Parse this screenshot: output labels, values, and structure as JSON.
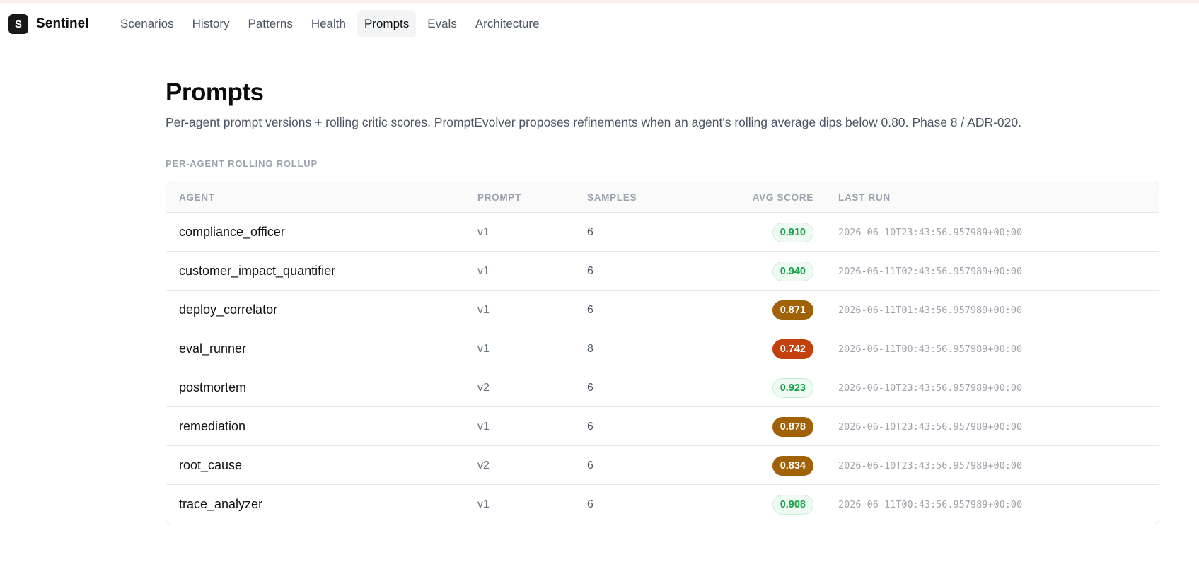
{
  "app": {
    "logo_letter": "S",
    "name": "Sentinel"
  },
  "nav": [
    {
      "label": "Scenarios",
      "active": false
    },
    {
      "label": "History",
      "active": false
    },
    {
      "label": "Patterns",
      "active": false
    },
    {
      "label": "Health",
      "active": false
    },
    {
      "label": "Prompts",
      "active": true
    },
    {
      "label": "Evals",
      "active": false
    },
    {
      "label": "Architecture",
      "active": false
    }
  ],
  "page": {
    "title": "Prompts",
    "description": "Per-agent prompt versions + rolling critic scores. PromptEvolver proposes refinements when an agent's rolling average dips below 0.80. Phase 8 / ADR-020.",
    "section_label": "PER-AGENT ROLLING ROLLUP"
  },
  "table": {
    "headers": {
      "agent": "AGENT",
      "prompt": "PROMPT",
      "samples": "SAMPLES",
      "avg_score": "AVG SCORE",
      "last_run": "LAST RUN"
    },
    "rows": [
      {
        "agent": "compliance_officer",
        "prompt": "v1",
        "samples": "6",
        "avg_score": "0.910",
        "status": "good",
        "last_run": "2026-06-10T23:43:56.957989+00:00"
      },
      {
        "agent": "customer_impact_quantifier",
        "prompt": "v1",
        "samples": "6",
        "avg_score": "0.940",
        "status": "good",
        "last_run": "2026-06-11T02:43:56.957989+00:00"
      },
      {
        "agent": "deploy_correlator",
        "prompt": "v1",
        "samples": "6",
        "avg_score": "0.871",
        "status": "warn",
        "last_run": "2026-06-11T01:43:56.957989+00:00"
      },
      {
        "agent": "eval_runner",
        "prompt": "v1",
        "samples": "8",
        "avg_score": "0.742",
        "status": "bad",
        "last_run": "2026-06-11T00:43:56.957989+00:00"
      },
      {
        "agent": "postmortem",
        "prompt": "v2",
        "samples": "6",
        "avg_score": "0.923",
        "status": "good",
        "last_run": "2026-06-10T23:43:56.957989+00:00"
      },
      {
        "agent": "remediation",
        "prompt": "v1",
        "samples": "6",
        "avg_score": "0.878",
        "status": "warn",
        "last_run": "2026-06-10T23:43:56.957989+00:00"
      },
      {
        "agent": "root_cause",
        "prompt": "v2",
        "samples": "6",
        "avg_score": "0.834",
        "status": "warn",
        "last_run": "2026-06-10T23:43:56.957989+00:00"
      },
      {
        "agent": "trace_analyzer",
        "prompt": "v1",
        "samples": "6",
        "avg_score": "0.908",
        "status": "good",
        "last_run": "2026-06-11T00:43:56.957989+00:00"
      }
    ]
  },
  "colors": {
    "score_good_text": "#16a34a",
    "score_good_bg": "#effaf3",
    "score_warn_bg": "#a16207",
    "score_bad_bg": "#c2410c",
    "logo_bg": "#18181b"
  }
}
